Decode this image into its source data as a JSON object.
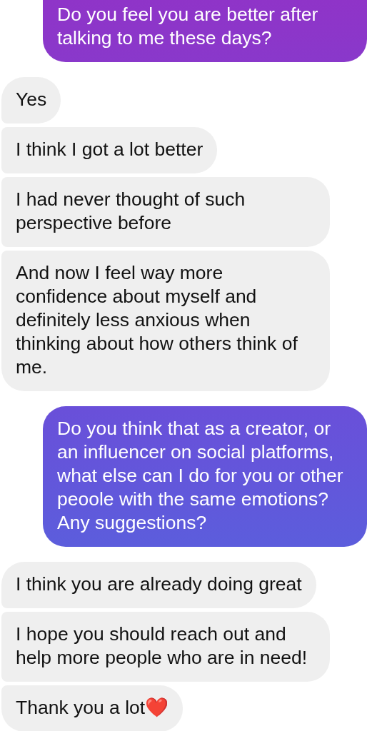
{
  "messages": [
    {
      "kind": "sent",
      "text": "Do you feel you are better after talking to me these days?"
    },
    {
      "kind": "received",
      "text": "Yes"
    },
    {
      "kind": "received",
      "text": "I think I got a lot better"
    },
    {
      "kind": "received",
      "text": "I had never thought of such perspective before"
    },
    {
      "kind": "received",
      "text": "And now I feel way more confidence about myself and definitely less anxious when thinking about how others think of me."
    },
    {
      "kind": "sent",
      "text": "Do you think that as a creator, or an influencer on social platforms, what else can I do for you or other peoole with the same emotions? Any suggestions?"
    },
    {
      "kind": "received",
      "text": "I think you are already doing great"
    },
    {
      "kind": "received",
      "text": "I hope you should reach out and help more people who are in need!"
    },
    {
      "kind": "received",
      "text": "Thank you a lot❤️"
    }
  ]
}
